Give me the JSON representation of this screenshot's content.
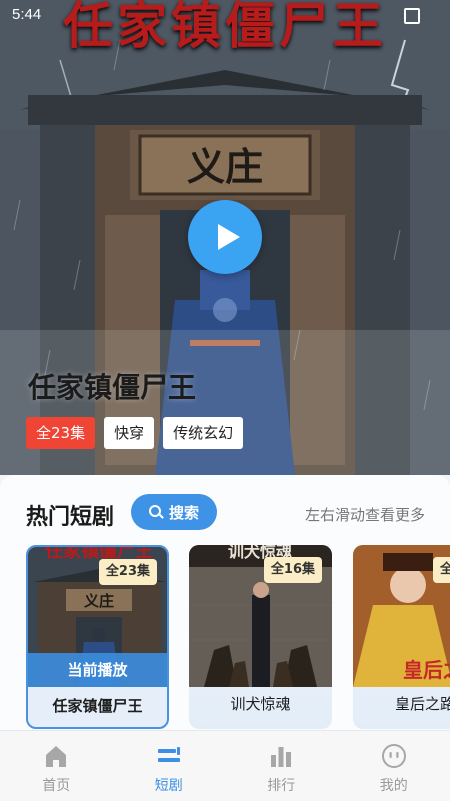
{
  "status_bar": {
    "time": "5:44"
  },
  "hero": {
    "poster_text": "任家镇僵尸王",
    "gate_plaque": "义庄",
    "title": "任家镇僵尸王",
    "tags": [
      {
        "label": "全23集",
        "style": "primary"
      },
      {
        "label": "快穿",
        "style": "plain"
      },
      {
        "label": "传统玄幻",
        "style": "plain"
      }
    ]
  },
  "section": {
    "title": "热门短剧",
    "search_label": "搜索",
    "scroll_hint": "左右滑动查看更多"
  },
  "cards": [
    {
      "name": "任家镇僵尸王",
      "episodes": "全23集",
      "now_playing": "当前播放",
      "active": true,
      "thumb_text": "任家镇僵尸王",
      "thumb_plaque": "义庄"
    },
    {
      "name": "训犬惊魂",
      "episodes": "全16集",
      "active": false,
      "thumb_text": "训犬惊魂"
    },
    {
      "name": "皇后之路",
      "episodes": "全",
      "active": false,
      "thumb_text": "皇后之"
    }
  ],
  "tabbar": {
    "items": [
      {
        "label": "首页",
        "icon": "home-icon",
        "active": false
      },
      {
        "label": "短剧",
        "icon": "short-drama-icon",
        "active": true
      },
      {
        "label": "排行",
        "icon": "ranking-icon",
        "active": false
      },
      {
        "label": "我的",
        "icon": "profile-icon",
        "active": false
      }
    ]
  },
  "colors": {
    "accent": "#3b8fe4",
    "tag_primary": "#f04435",
    "badge": "#fbeec6",
    "poster_red": "#b71c1c"
  }
}
